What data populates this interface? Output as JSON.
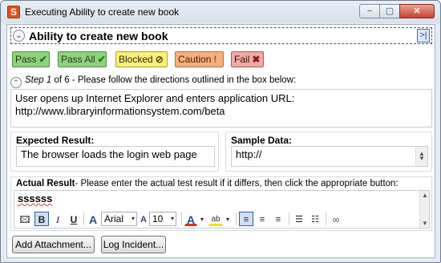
{
  "window": {
    "title": "Executing Ability to create new book",
    "app_icon_glyph": "S",
    "minimize_glyph": "−",
    "maximize_glyph": "▢",
    "close_glyph": "✕"
  },
  "header": {
    "title": "Ability to create new book",
    "collapse_glyph": "⌄",
    "expand_glyph": ">|"
  },
  "status_buttons": {
    "pass": {
      "label": "Pass",
      "icon": "check-icon",
      "glyph": "✔",
      "color": "#8fd17d"
    },
    "pass_all": {
      "label": "Pass All",
      "icon": "double-check-icon",
      "glyph": "✔",
      "color": "#8fd17d"
    },
    "blocked": {
      "label": "Blocked",
      "icon": "blocked-icon",
      "glyph": "⊘",
      "color": "#f8f07b"
    },
    "caution": {
      "label": "Caution",
      "icon": "exclamation-icon",
      "glyph": "!",
      "color": "#f6b07e"
    },
    "fail": {
      "label": "Fail",
      "icon": "x-icon",
      "glyph": "✖",
      "color": "#f1a9a4"
    }
  },
  "step": {
    "prefix": "Step 1",
    "suffix": " of 6 - Please follow the directions outlined in the box below:",
    "collapse_glyph": "⌃"
  },
  "description": "User opens up Internet Explorer and enters application URL: http://www.libraryinformationsystem.com/beta",
  "expected": {
    "label": "Expected Result:",
    "value": "The browser loads the login web page"
  },
  "sample": {
    "label": "Sample Data:",
    "value": "http://"
  },
  "actual": {
    "label_bold": "Actual Result",
    "label_rest": "- Please enter the actual test result if it differs, then click the appropriate button:",
    "value": "ssssss"
  },
  "toolbar": {
    "bold": "B",
    "italic": "I",
    "underline": "U",
    "font_glyph": "A",
    "font_name": "Arial",
    "font_size": "10",
    "font_size_glyph": "A",
    "font_color_glyph": "A",
    "highlight_glyph": "ab",
    "dropdown_glyph": "▾"
  },
  "buttons": {
    "add_attachment": "Add Attachment...",
    "log_incident": "Log Incident..."
  }
}
